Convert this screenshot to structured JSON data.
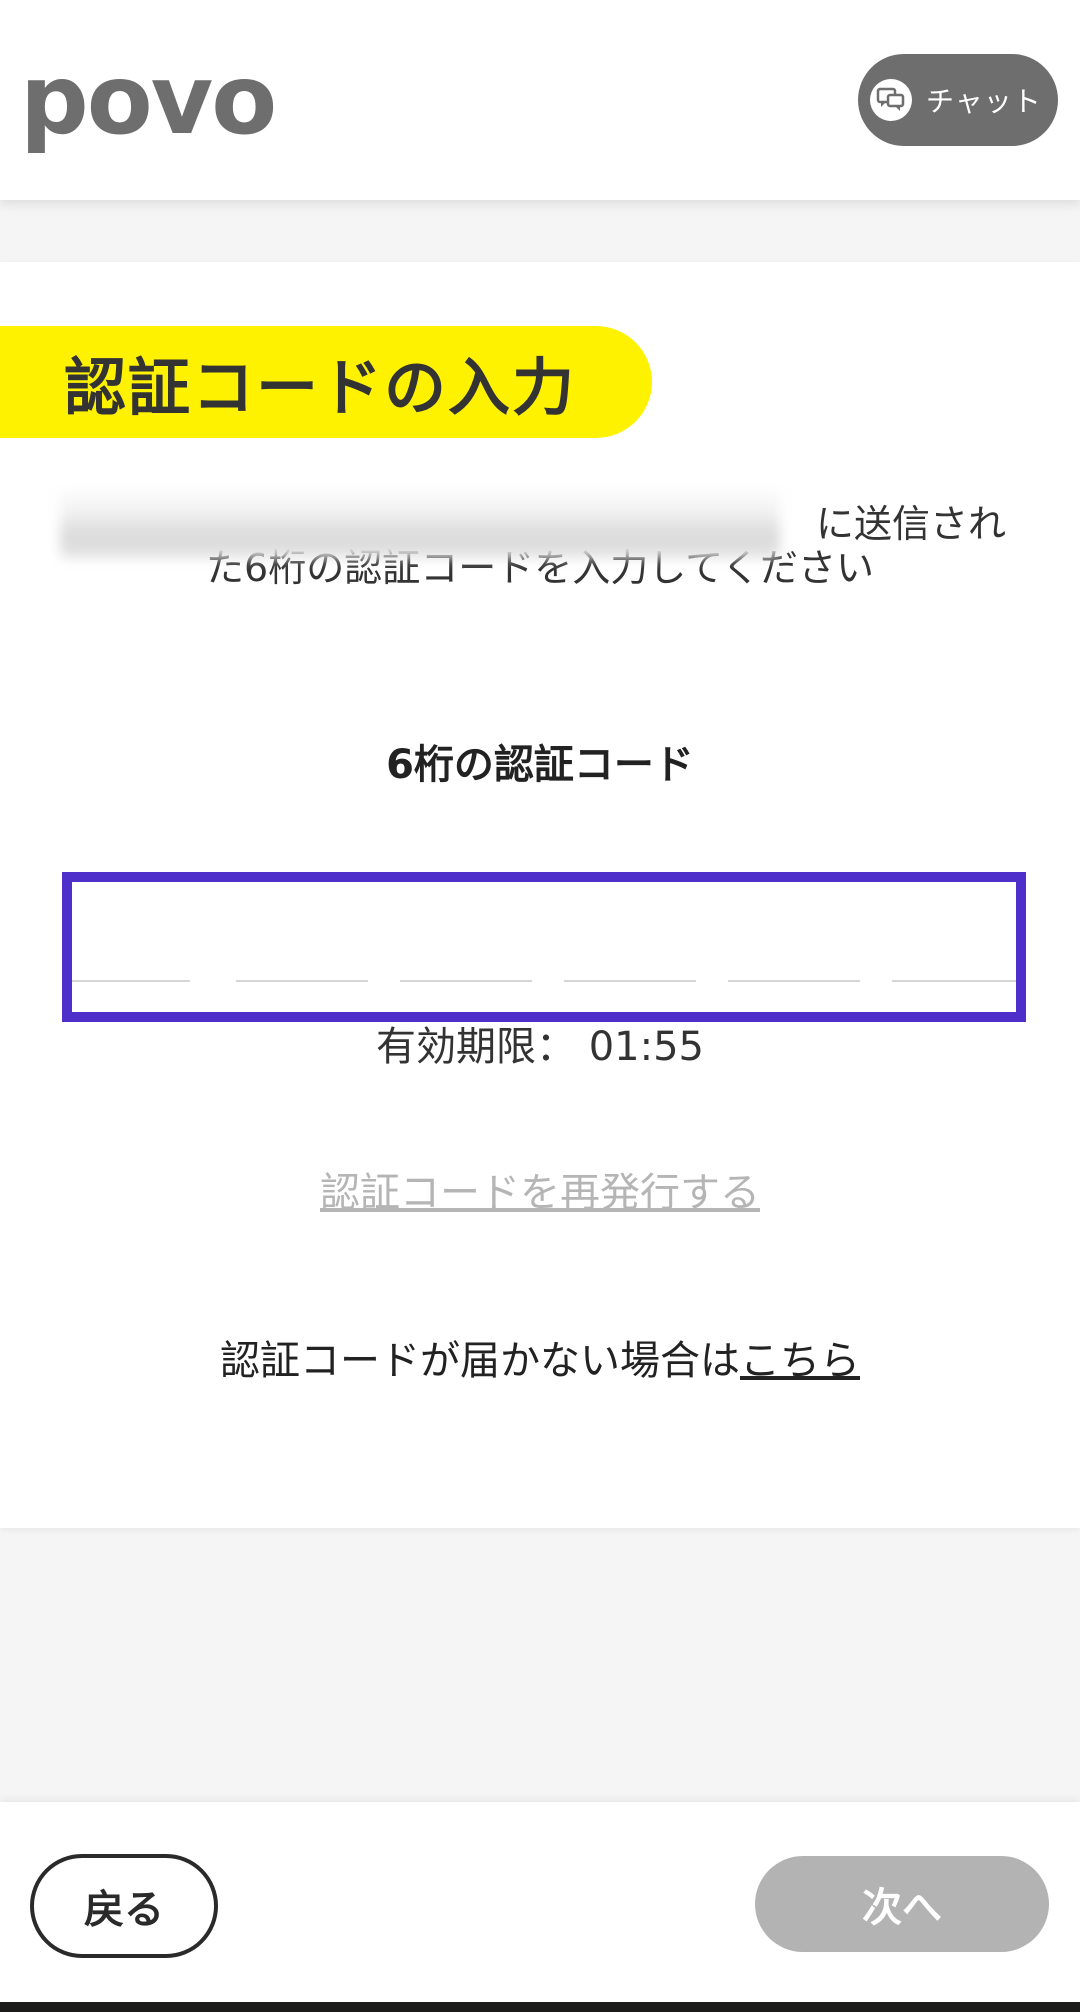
{
  "header": {
    "logo_text": "povo",
    "chat_label": "チャット"
  },
  "card": {
    "title": "認証コードの入力",
    "description_line1": "に送信され",
    "description_line2": "た6桁の認証コードを入力してください",
    "code_label": "6桁の認証コード",
    "digits": [
      "",
      "",
      "",
      "",
      "",
      ""
    ],
    "expiry_label": "有効期限：",
    "expiry_time": "01:55",
    "reissue_label": "認証コードを再発行する",
    "help_prefix": "認証コードが届かない場合は",
    "help_link": "こちら"
  },
  "footer": {
    "back_label": "戻る",
    "next_label": "次へ"
  },
  "colors": {
    "accent_yellow": "#fff200",
    "focus_purple": "#4f2fc9",
    "brand_gray": "#6e6e6e",
    "disabled_gray": "#b3b3b3"
  }
}
